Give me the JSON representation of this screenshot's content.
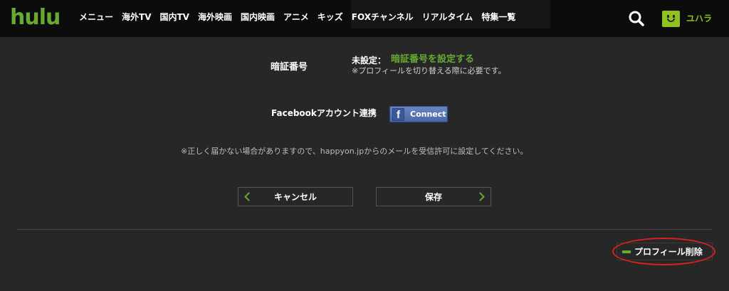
{
  "header": {
    "logo": "hulu",
    "nav": [
      "メニュー",
      "海外TV",
      "国内TV",
      "海外映画",
      "国内映画",
      "アニメ",
      "キッズ",
      "FOXチャンネル",
      "リアルタイム",
      "特集一覧"
    ],
    "search_icon": "search-icon",
    "username": "ユハラ"
  },
  "form": {
    "pin_label": "暗証番号",
    "pin_status": "未設定：",
    "pin_link": "暗証番号を設定する",
    "pin_note": "※プロフィールを切り替える際に必要です。",
    "facebook_label": "Facebookアカウント連携",
    "facebook_icon": "f",
    "facebook_button": "Connect",
    "notice": "※正しく届かない場合がありますので、happyon.jpからのメールを受信許可に設定してください。"
  },
  "actions": {
    "cancel": "キャンセル",
    "save": "保存",
    "delete_profile": "プロフィール削除"
  },
  "colors": {
    "accent_green": "#66aa33",
    "avatar_green": "#8dc21f",
    "background": "#272727",
    "annotation_red": "#d8211f"
  }
}
